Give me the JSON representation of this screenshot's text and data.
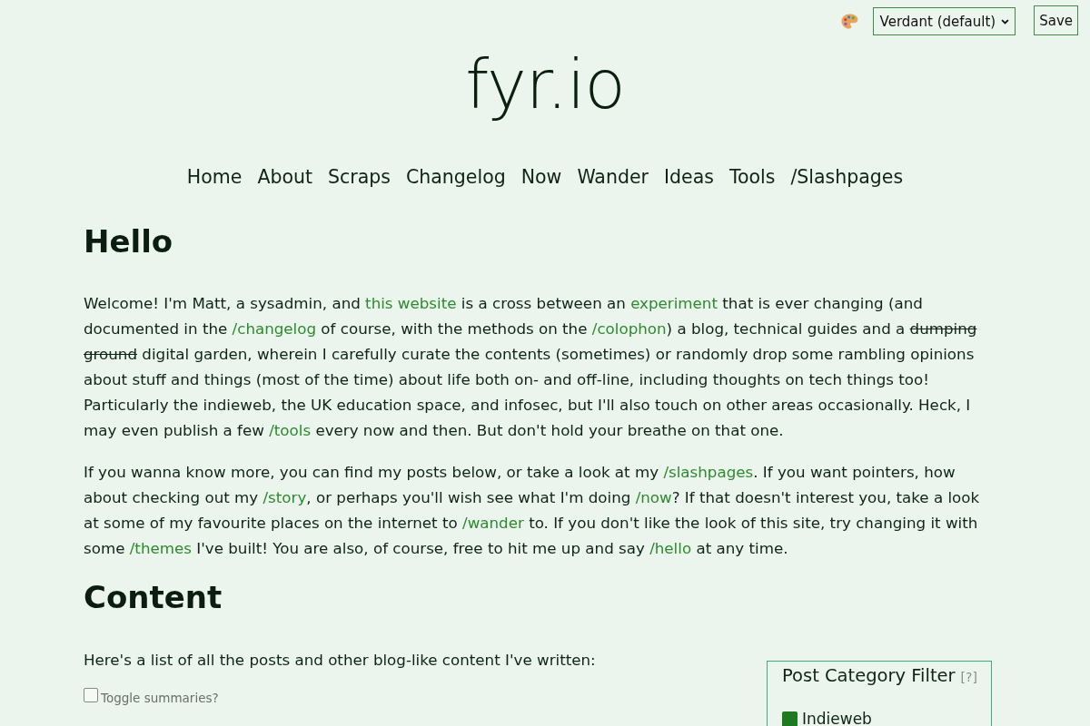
{
  "theme_switcher": {
    "selected_theme": "Verdant (default)",
    "save_button": "Save"
  },
  "site_title": "fyr.io",
  "nav": [
    "Home",
    "About",
    "Scraps",
    "Changelog",
    "Now",
    "Wander",
    "Ideas",
    "Tools",
    "/Slashpages"
  ],
  "hello": {
    "heading": "Hello",
    "paragraphs": [
      [
        {
          "kind": "text",
          "text": "Welcome! I'm Matt, a sysadmin, and "
        },
        {
          "kind": "link",
          "text": "this website"
        },
        {
          "kind": "text",
          "text": " is a cross between an "
        },
        {
          "kind": "link",
          "text": "experiment"
        },
        {
          "kind": "text",
          "text": " that is ever changing (and documented in the "
        },
        {
          "kind": "link",
          "text": "/changelog"
        },
        {
          "kind": "text",
          "text": " of course, with the methods on the "
        },
        {
          "kind": "link",
          "text": "/colophon"
        },
        {
          "kind": "text",
          "text": ") a blog, technical guides and a "
        },
        {
          "kind": "strike",
          "text": "dumping ground"
        },
        {
          "kind": "text",
          "text": " digital garden, wherein I carefully curate the contents (sometimes) or randomly drop some rambling opinions about stuff and things (most of the time) about life both on- and off-line, including thoughts on tech things too! Particularly the indieweb, the UK education space, and infosec, but I'll also touch on other areas occasionally. Heck, I may even publish a few "
        },
        {
          "kind": "link",
          "text": "/tools"
        },
        {
          "kind": "text",
          "text": " every now and then. But don't hold your breathe on that one."
        }
      ],
      [
        {
          "kind": "text",
          "text": "If you wanna know more, you can find my posts below, or take a look at my "
        },
        {
          "kind": "link",
          "text": "/slashpages"
        },
        {
          "kind": "text",
          "text": ". If you want pointers, how about checking out my "
        },
        {
          "kind": "link",
          "text": "/story"
        },
        {
          "kind": "text",
          "text": ", or perhaps you'll wish see what I'm doing "
        },
        {
          "kind": "link",
          "text": "/now"
        },
        {
          "kind": "text",
          "text": "? If that doesn't interest you, take a look at some of my favourite places on the internet to "
        },
        {
          "kind": "link",
          "text": "/wander"
        },
        {
          "kind": "text",
          "text": " to. If you don't like the look of this site, try changing it with some "
        },
        {
          "kind": "link",
          "text": "/themes"
        },
        {
          "kind": "text",
          "text": " I've built! You are also, of course, free to hit me up and say "
        },
        {
          "kind": "link",
          "text": "/hello"
        },
        {
          "kind": "text",
          "text": " at any time."
        }
      ]
    ]
  },
  "content": {
    "heading": "Content",
    "intro": "Here's a list of all the posts and other blog-like content I've written:",
    "toggle": {
      "label": "Toggle summaries?",
      "checked": false
    },
    "category_filter": {
      "title": "Post Category Filter",
      "help_link": "[?]",
      "categories": [
        {
          "label": "Indieweb",
          "color": "#1e7a1e"
        }
      ]
    }
  }
}
